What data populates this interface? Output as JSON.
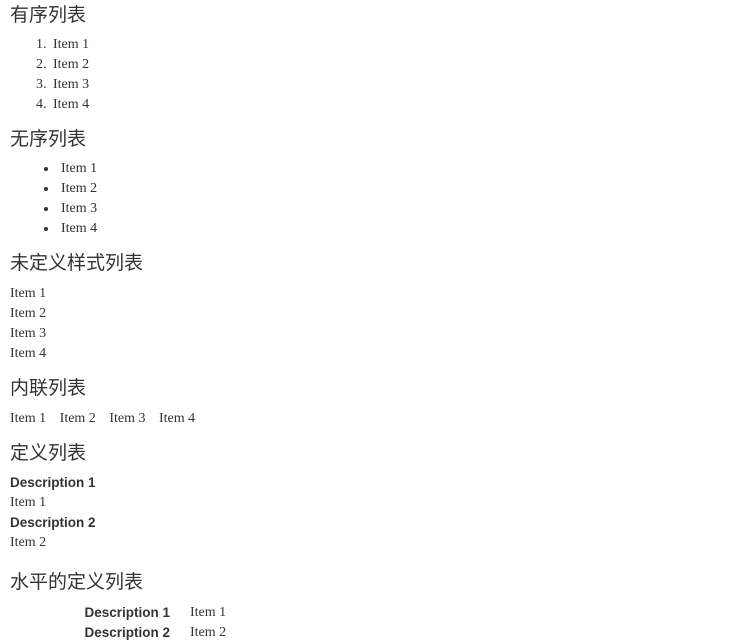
{
  "page": {
    "background_color": "#ffffff",
    "text_color": "#333333"
  },
  "sections": [
    {
      "id": "ordered",
      "heading": "有序列表",
      "list_type": "ordered",
      "marker": "decimal",
      "items": [
        "Item 1",
        "Item 2",
        "Item 3",
        "Item 4"
      ]
    },
    {
      "id": "unordered",
      "heading": "无序列表",
      "list_type": "unordered",
      "marker": "disc",
      "items": [
        "Item 1",
        "Item 2",
        "Item 3",
        "Item 4"
      ]
    },
    {
      "id": "unstyled",
      "heading": "未定义样式列表",
      "list_type": "unstyled",
      "marker": "none",
      "items": [
        "Item 1",
        "Item 2",
        "Item 3",
        "Item 4"
      ]
    },
    {
      "id": "inline",
      "heading": "内联列表",
      "list_type": "inline",
      "marker": "none",
      "items": [
        "Item 1",
        "Item 2",
        "Item 3",
        "Item 4"
      ]
    },
    {
      "id": "definition",
      "heading": "定义列表",
      "list_type": "definition",
      "pairs": [
        {
          "term": "Description 1",
          "description": "Item 1"
        },
        {
          "term": "Description 2",
          "description": "Item 2"
        }
      ]
    },
    {
      "id": "definition-horizontal",
      "heading": "水平的定义列表",
      "list_type": "definition-horizontal",
      "pairs": [
        {
          "term": "Description 1",
          "description": "Item 1"
        },
        {
          "term": "Description 2",
          "description": "Item 2"
        }
      ]
    }
  ]
}
